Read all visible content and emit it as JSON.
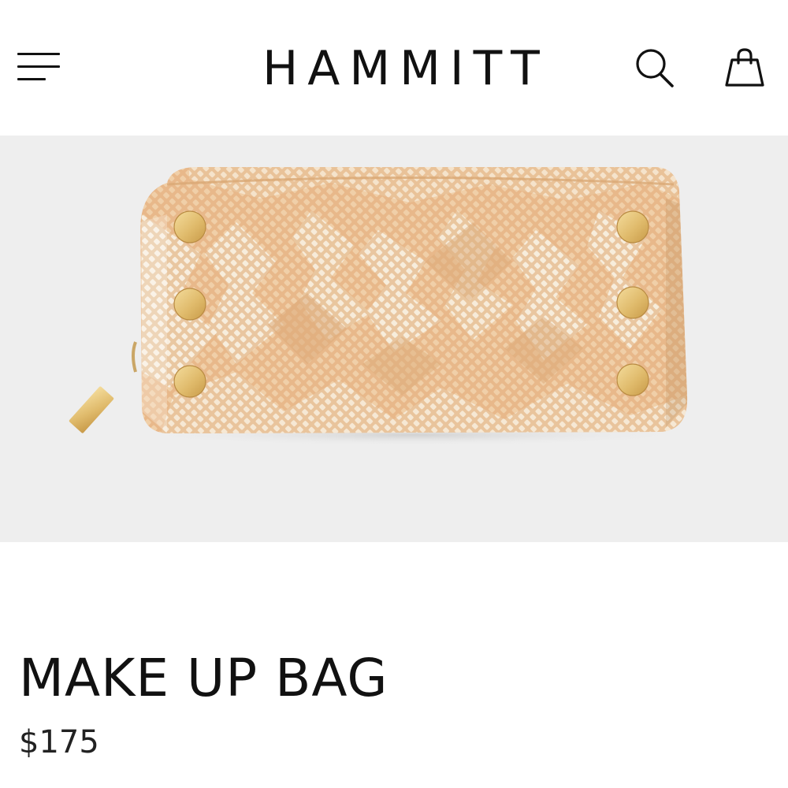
{
  "header": {
    "menu_icon": "hamburger-menu-icon",
    "logo_text": "HAMMITT",
    "search_icon": "search-icon",
    "bag_icon": "shopping-bag-icon"
  },
  "product": {
    "image_alt": "Make Up Bag",
    "title": "MAKE UP BAG",
    "price": "$175"
  },
  "colors": {
    "background": "#ffffff",
    "image_background": "#eeeeee",
    "bag_tan": "#e6b486",
    "bag_light": "#f1dcc0",
    "hardware_gold": "#e2c27c"
  }
}
